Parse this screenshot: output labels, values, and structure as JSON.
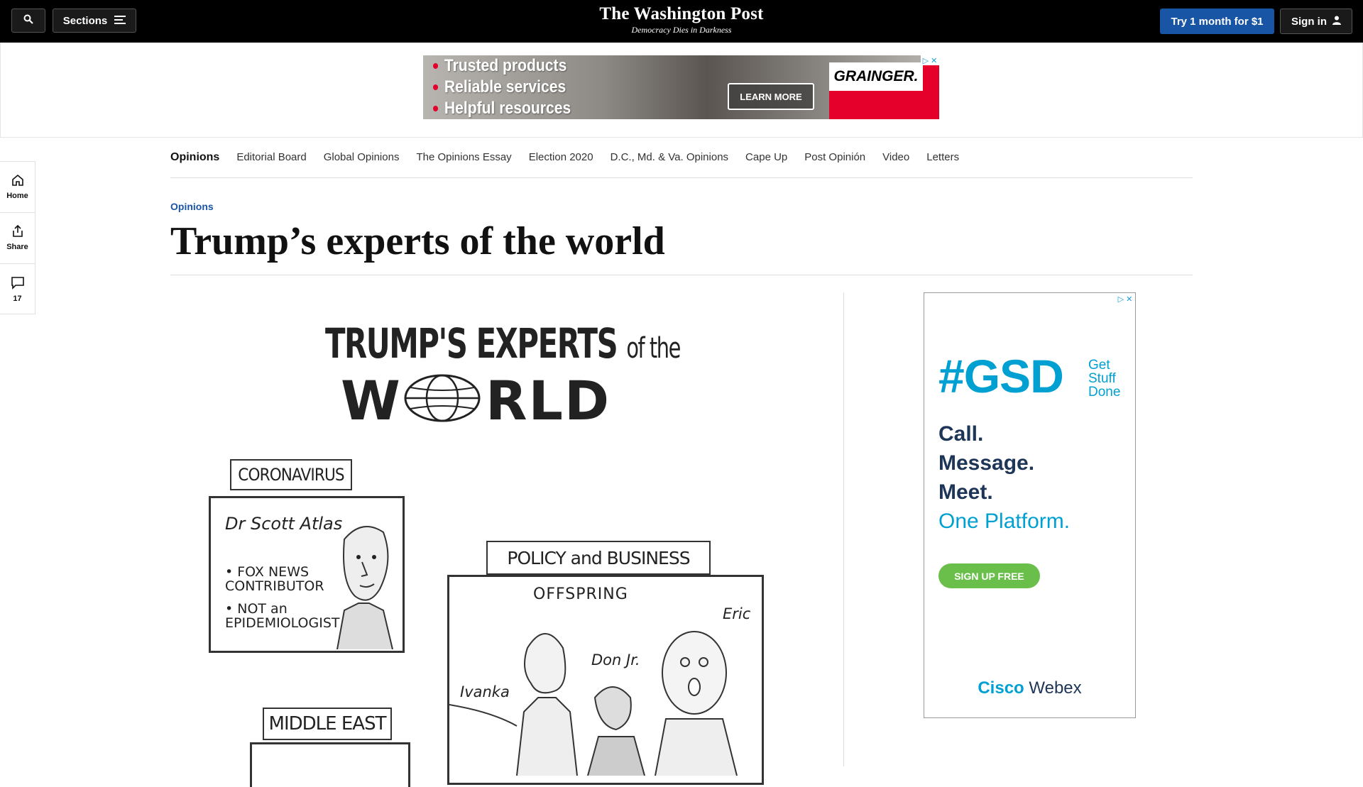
{
  "header": {
    "sections_label": "Sections",
    "logo": "The Washington Post",
    "tagline": "Democracy Dies in Darkness",
    "subscribe_label": "Try 1 month for $1",
    "signin_label": "Sign in"
  },
  "banner_ad": {
    "items": [
      "Trusted products",
      "Reliable services",
      "Helpful resources"
    ],
    "cta": "LEARN MORE",
    "brand": "GRAINGER."
  },
  "rail": {
    "home": "Home",
    "share": "Share",
    "comments_count": "17"
  },
  "subnav": {
    "items": [
      "Opinions",
      "Editorial Board",
      "Global Opinions",
      "The Opinions Essay",
      "Election 2020",
      "D.C., Md. & Va. Opinions",
      "Cape Up",
      "Post Opinión",
      "Video",
      "Letters"
    ]
  },
  "article": {
    "kicker": "Opinions",
    "headline": "Trump’s experts of the world"
  },
  "cartoon": {
    "title_line1": "TRUMP'S EXPERTS",
    "title_of_the": "of the",
    "title_world_w": "W",
    "title_world_rest": "RLD",
    "box1_caption": "CORONAVIRUS",
    "box1_name": "Dr Scott Atlas",
    "box1_bullet1": "• FOX NEWS CONTRIBUTOR",
    "box1_bullet2": "• NOT an EPIDEMIOLOGIST",
    "box2_caption": "POLICY and BUSINESS",
    "box2_sub": "OFFSPRING",
    "box2_eric": "Eric",
    "box2_don": "Don Jr.",
    "box2_ivanka": "Ivanka",
    "box3_caption": "MIDDLE EAST"
  },
  "side_ad": {
    "headline": "#GSD",
    "sub": [
      "Get",
      "Stuff",
      "Done"
    ],
    "lines": [
      "Call.",
      "Message.",
      "Meet."
    ],
    "platform": "One Platform.",
    "cta": "SIGN UP FREE",
    "brand_bold": "Cisco",
    "brand_rest": "Webex"
  }
}
